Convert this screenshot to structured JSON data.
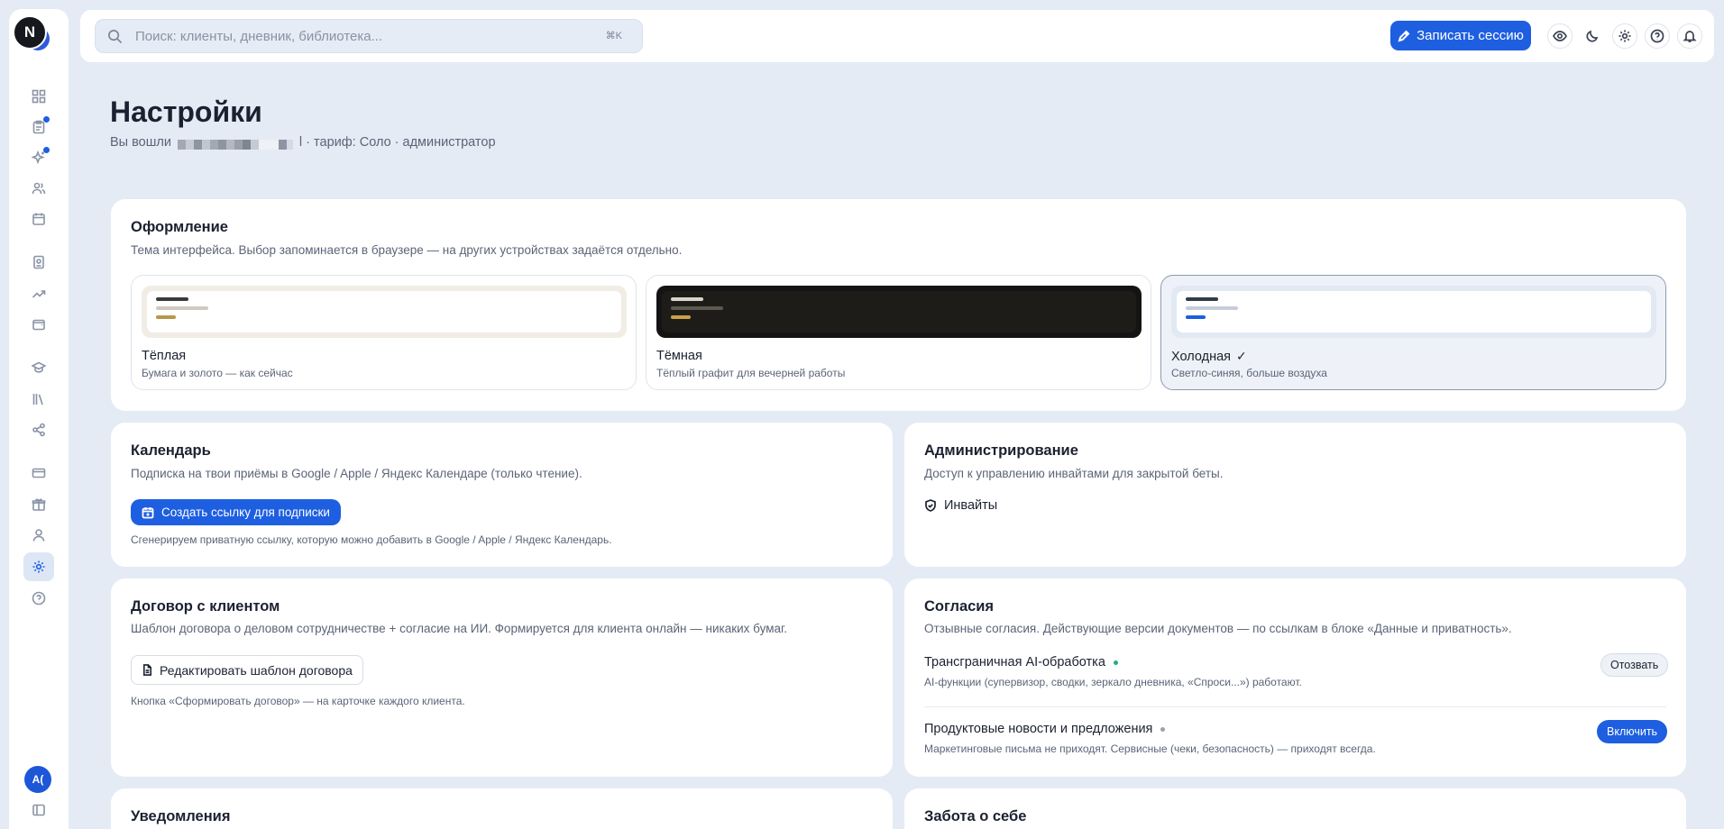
{
  "sidebar": {
    "logo_letter": "N",
    "avatar_initials": "A(",
    "items": [
      {
        "icon": "dashboard-icon"
      },
      {
        "icon": "clipboard-icon",
        "badge": true
      },
      {
        "icon": "sparkles-icon",
        "badge": true
      },
      {
        "icon": "users-icon"
      },
      {
        "icon": "calendar-icon"
      },
      {
        "icon": "document-icon"
      },
      {
        "icon": "trending-icon"
      },
      {
        "icon": "wallet-icon"
      },
      {
        "icon": "graduation-icon"
      },
      {
        "icon": "library-icon"
      },
      {
        "icon": "share-icon"
      },
      {
        "icon": "card-icon"
      },
      {
        "icon": "gift-icon"
      },
      {
        "icon": "user-icon"
      },
      {
        "icon": "gear-icon",
        "active": true
      },
      {
        "icon": "help-icon"
      },
      {
        "icon": "sidebar-toggle-icon"
      }
    ]
  },
  "topbar": {
    "search_placeholder": "Поиск: клиенты, дневник, библиотека...",
    "shortcut": "⌘K",
    "record_label": "Записать сессию"
  },
  "page": {
    "title": "Настройки",
    "subtitle_prefix": "Вы вошли",
    "subtitle_suffix": "l · тариф: Соло · администратор"
  },
  "appearance": {
    "title": "Оформление",
    "description": "Тема интерфейса. Выбор запоминается в браузере — на других устройствах задаётся отдельно.",
    "themes": [
      {
        "name": "Тёплая",
        "description": "Бумага и золото — как сейчас",
        "selected": false,
        "bg": "#f1ede4",
        "inner": "#ffffff",
        "line1": "#3a3a3a",
        "line2": "#cfcac0",
        "accent": "#b8954a"
      },
      {
        "name": "Тёмная",
        "description": "Тёплый графит для вечерней работы",
        "selected": false,
        "bg": "#141414",
        "inner": "#1e1c19",
        "line1": "#d8d4cc",
        "line2": "#5c5850",
        "accent": "#c9a24a"
      },
      {
        "name": "Холодная",
        "description": "Светло-синяя, больше воздуха",
        "selected": true,
        "bg": "#e2e9f3",
        "inner": "#ffffff",
        "line1": "#333a48",
        "line2": "#c6cdd8",
        "accent": "#1d5fe0"
      }
    ]
  },
  "calendar": {
    "title": "Календарь",
    "description": "Подписка на твои приёмы в Google / Apple / Яндекс Календаре (только чтение).",
    "button_label": "Создать ссылку для подписки",
    "hint": "Сгенерируем приватную ссылку, которую можно добавить в Google / Apple / Яндекс Календарь."
  },
  "admin": {
    "title": "Администрирование",
    "description": "Доступ к управлению инвайтами для закрытой беты.",
    "link_label": "Инвайты"
  },
  "contract": {
    "title": "Договор с клиентом",
    "description": "Шаблон договора о деловом сотрудничестве + согласие на ИИ. Формируется для клиента онлайн — никаких бумаг.",
    "button_label": "Редактировать шаблон договора",
    "hint": "Кнопка «Сформировать договор» — на карточке каждого клиента."
  },
  "consents": {
    "title": "Согласия",
    "description": "Отзывные согласия. Действующие версии документов — по ссылкам в блоке «Данные и приватность».",
    "items": [
      {
        "title": "Трансграничная AI-обработка",
        "status_color": "#22b07d",
        "description": "AI-функции (супервизор, сводки, зеркало дневника, «Спроси...») работают.",
        "action": "Отозвать"
      },
      {
        "title": "Продуктовые новости и предложения",
        "status_color": "#9aa1ad",
        "description": "Маркетинговые письма не приходят. Сервисные (чеки, безопасность) — приходят всегда.",
        "action": "Включить"
      }
    ]
  },
  "notifications": {
    "title": "Уведомления"
  },
  "selfcare": {
    "title": "Забота о себе"
  }
}
